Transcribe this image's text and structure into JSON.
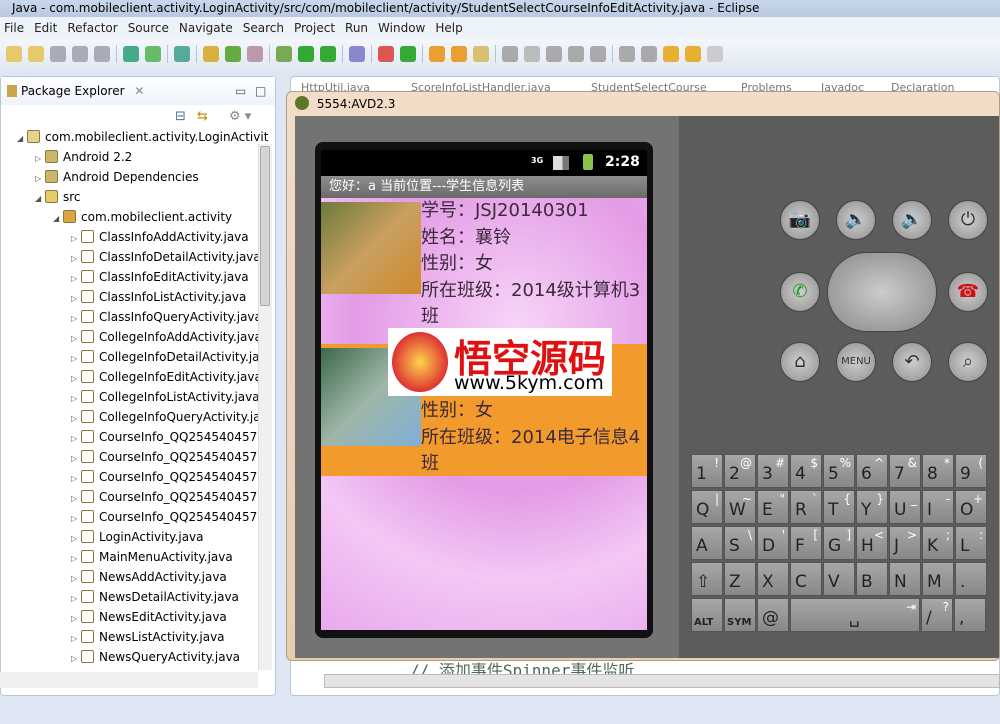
{
  "window": {
    "title": "Java - com.mobileclient.activity.LoginActivity/src/com/mobileclient/activity/StudentSelectCourseInfoEditActivity.java - Eclipse"
  },
  "menu": [
    "File",
    "Edit",
    "Refactor",
    "Source",
    "Navigate",
    "Search",
    "Project",
    "Run",
    "Window",
    "Help"
  ],
  "package_explorer": {
    "title": "Package Explorer",
    "items": [
      {
        "label": "com.mobileclient.activity.LoginActivit",
        "level": 0,
        "icon": "project-icon"
      },
      {
        "label": "Android 2.2",
        "level": 1,
        "icon": "library-icon"
      },
      {
        "label": "Android Dependencies",
        "level": 1,
        "icon": "library-icon"
      },
      {
        "label": "src",
        "level": 1,
        "icon": "source-folder-icon"
      },
      {
        "label": "com.mobileclient.activity",
        "level": 2,
        "icon": "package-icon"
      },
      {
        "label": "ClassInfoAddActivity.java",
        "level": 3,
        "icon": "java-file-icon"
      },
      {
        "label": "ClassInfoDetailActivity.java",
        "level": 3,
        "icon": "java-file-icon"
      },
      {
        "label": "ClassInfoEditActivity.java",
        "level": 3,
        "icon": "java-file-icon"
      },
      {
        "label": "ClassInfoListActivity.java",
        "level": 3,
        "icon": "java-file-icon"
      },
      {
        "label": "ClassInfoQueryActivity.java",
        "level": 3,
        "icon": "java-file-icon"
      },
      {
        "label": "CollegeInfoAddActivity.java",
        "level": 3,
        "icon": "java-file-icon"
      },
      {
        "label": "CollegeInfoDetailActivity.ja",
        "level": 3,
        "icon": "java-file-icon"
      },
      {
        "label": "CollegeInfoEditActivity.java",
        "level": 3,
        "icon": "java-file-icon"
      },
      {
        "label": "CollegeInfoListActivity.java",
        "level": 3,
        "icon": "java-file-icon"
      },
      {
        "label": "CollegeInfoQueryActivity.ja",
        "level": 3,
        "icon": "java-file-icon"
      },
      {
        "label": "CourseInfo_QQ254540457.",
        "level": 3,
        "icon": "java-file-icon"
      },
      {
        "label": "CourseInfo_QQ254540457",
        "level": 3,
        "icon": "java-file-icon"
      },
      {
        "label": "CourseInfo_QQ254540457",
        "level": 3,
        "icon": "java-file-icon"
      },
      {
        "label": "CourseInfo_QQ254540457",
        "level": 3,
        "icon": "java-file-icon"
      },
      {
        "label": "CourseInfo_QQ254540457",
        "level": 3,
        "icon": "java-file-icon"
      },
      {
        "label": "LoginActivity.java",
        "level": 3,
        "icon": "java-file-icon"
      },
      {
        "label": "MainMenuActivity.java",
        "level": 3,
        "icon": "java-file-icon"
      },
      {
        "label": "NewsAddActivity.java",
        "level": 3,
        "icon": "java-file-icon"
      },
      {
        "label": "NewsDetailActivity.java",
        "level": 3,
        "icon": "java-file-icon"
      },
      {
        "label": "NewsEditActivity.java",
        "level": 3,
        "icon": "java-file-icon"
      },
      {
        "label": "NewsListActivity.java",
        "level": 3,
        "icon": "java-file-icon"
      },
      {
        "label": "NewsQueryActivity.java",
        "level": 3,
        "icon": "java-file-icon"
      }
    ]
  },
  "editor": {
    "tabs": [
      "HttpUtil.java",
      "ScoreInfoListHandler.java",
      "StudentSelectCourse",
      "Problems",
      "Javadoc",
      "Declaration"
    ],
    "code_line": "//  添加事件Spinner事件监听"
  },
  "emulator": {
    "title": "5554:AVD2.3",
    "status": {
      "network": "3G",
      "time": "2:28"
    },
    "app_title": "您好：a   当前位置---学生信息列表",
    "students": [
      {
        "lines": [
          "学号：JSJ20140301",
          "姓名：襄铃",
          "性别：女",
          "所在班级：2014级计算机3班"
        ],
        "bg": "transparent"
      },
      {
        "lines": [
          "性别：女",
          "所在班级：2014电子信息4班"
        ],
        "bg": "#f39a2c"
      }
    ],
    "watermark": {
      "title": "悟空源码",
      "url": "www.5kym.com"
    },
    "keyboard": [
      [
        [
          "1",
          "!"
        ],
        [
          "2",
          "@"
        ],
        [
          "3",
          "#"
        ],
        [
          "4",
          "$"
        ],
        [
          "5",
          "%"
        ],
        [
          "6",
          "^"
        ],
        [
          "7",
          "&"
        ],
        [
          "8",
          "*"
        ],
        [
          "9",
          "("
        ]
      ],
      [
        [
          "Q",
          "|"
        ],
        [
          "W",
          "~"
        ],
        [
          "E",
          "\""
        ],
        [
          "R",
          "`"
        ],
        [
          "T",
          "{"
        ],
        [
          "Y",
          "}"
        ],
        [
          "U",
          "_"
        ],
        [
          "I",
          "-"
        ],
        [
          "O",
          "+"
        ]
      ],
      [
        [
          "A",
          ""
        ],
        [
          "S",
          "\\"
        ],
        [
          "D",
          "'"
        ],
        [
          "F",
          "["
        ],
        [
          "G",
          "]"
        ],
        [
          "H",
          "<"
        ],
        [
          "J",
          ">"
        ],
        [
          "K",
          ";"
        ],
        [
          "L",
          ":"
        ]
      ],
      [
        [
          "⇧",
          ""
        ],
        [
          "Z",
          ""
        ],
        [
          "X",
          ""
        ],
        [
          "C",
          ""
        ],
        [
          "V",
          ""
        ],
        [
          "B",
          ""
        ],
        [
          "N",
          ""
        ],
        [
          "M",
          ""
        ],
        [
          ".",
          ""
        ]
      ],
      [
        [
          "ALT",
          ""
        ],
        [
          "SYM",
          ""
        ],
        [
          "@",
          ""
        ],
        [
          "␣",
          "⇥"
        ],
        [
          "/",
          "?"
        ],
        [
          ",",
          ""
        ]
      ]
    ],
    "menu_key": "MENU"
  }
}
